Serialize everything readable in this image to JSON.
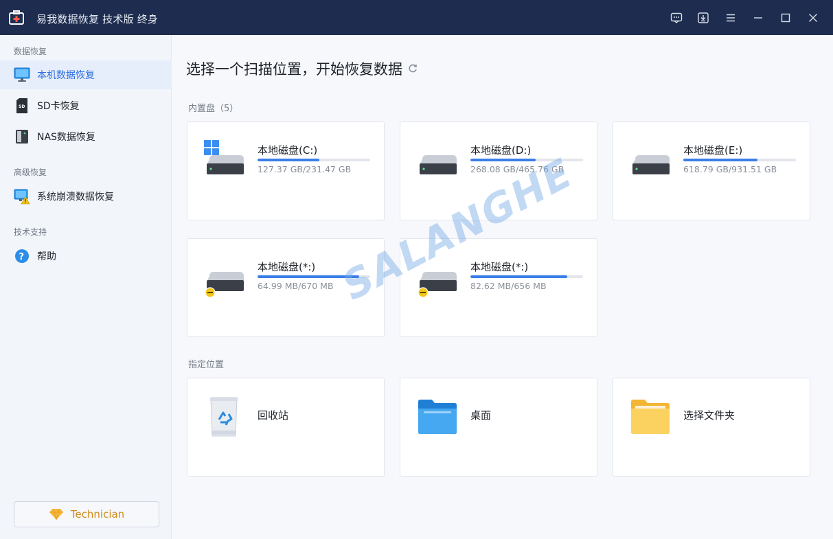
{
  "titlebar": {
    "title": "易我数据恢复 技术版 终身",
    "bg": "#1e2d4f"
  },
  "sidebar": {
    "sections": [
      {
        "label": "数据恢复"
      },
      {
        "label": "高级恢复"
      },
      {
        "label": "技术支持"
      }
    ],
    "items": [
      {
        "label": "本机数据恢复",
        "icon": "monitor-icon",
        "active": true
      },
      {
        "label": "SD卡恢复",
        "icon": "sd-card-icon"
      },
      {
        "label": "NAS数据恢复",
        "icon": "nas-icon"
      },
      {
        "label": "系统崩溃数据恢复",
        "icon": "system-crash-icon"
      },
      {
        "label": "帮助",
        "icon": "help-icon"
      }
    ],
    "technician_label": "Technician"
  },
  "main": {
    "heading": "选择一个扫描位置，开始恢复数据",
    "internal_label": "内置盘（5）",
    "drives": [
      {
        "name": "本地磁盘(C:)",
        "size": "127.37 GB/231.47 GB",
        "used_fraction": 0.55,
        "system": true
      },
      {
        "name": "本地磁盘(D:)",
        "size": "268.08 GB/465.76 GB",
        "used_fraction": 0.58
      },
      {
        "name": "本地磁盘(E:)",
        "size": "618.79 GB/931.51 GB",
        "used_fraction": 0.66
      },
      {
        "name": "本地磁盘(*:)",
        "size": "64.99 MB/670 MB",
        "used_fraction": 0.9,
        "unmounted": true
      },
      {
        "name": "本地磁盘(*:)",
        "size": "82.62 MB/656 MB",
        "used_fraction": 0.86,
        "unmounted": true
      }
    ],
    "location_label": "指定位置",
    "locations": [
      {
        "name": "回收站",
        "icon": "recycle-bin-icon"
      },
      {
        "name": "桌面",
        "icon": "desktop-folder-icon"
      },
      {
        "name": "选择文件夹",
        "icon": "folder-icon"
      }
    ]
  },
  "watermark": "SALANGHE",
  "colors": {
    "accent": "#3a7ee8",
    "active_text": "#2f6fe0",
    "technician": "#d18a1a"
  }
}
